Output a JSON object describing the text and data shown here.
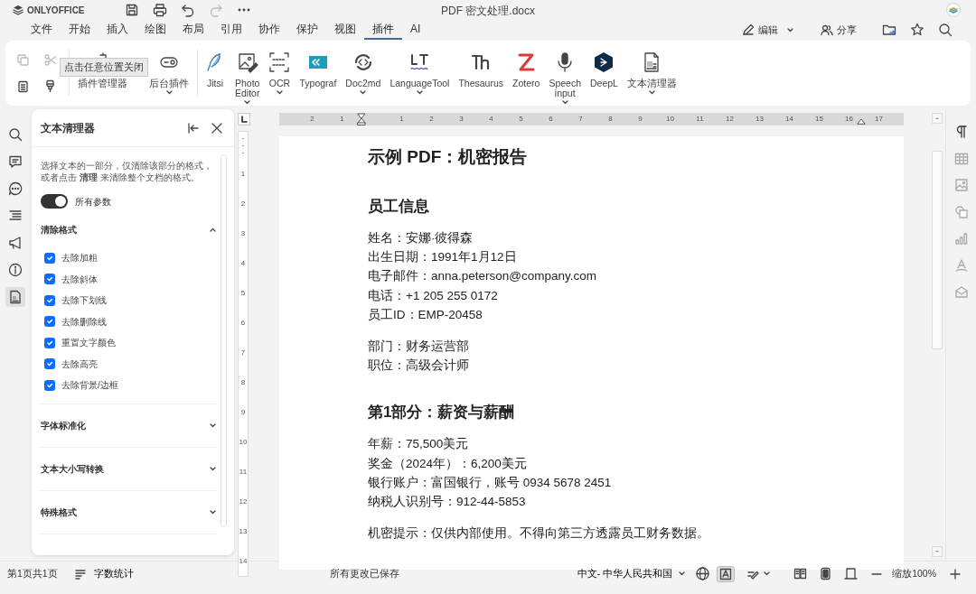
{
  "app": {
    "brand": "ONLYOFFICE",
    "title": "PDF 密文处理.docx"
  },
  "quick_access": {
    "undo": {
      "disabled": false
    },
    "redo": {
      "disabled": true
    }
  },
  "menu_tabs": [
    {
      "label": "文件",
      "selected": false
    },
    {
      "label": "开始",
      "selected": false
    },
    {
      "label": "插入",
      "selected": false
    },
    {
      "label": "绘图",
      "selected": false
    },
    {
      "label": "布局",
      "selected": false
    },
    {
      "label": "引用",
      "selected": false
    },
    {
      "label": "协作",
      "selected": false
    },
    {
      "label": "保护",
      "selected": false
    },
    {
      "label": "视图",
      "selected": false
    },
    {
      "label": "插件",
      "selected": true
    },
    {
      "label": "AI",
      "selected": false
    }
  ],
  "header_actions": {
    "edit_mode": "编辑",
    "share": "分享"
  },
  "toolbar": {
    "edit_buttons": [
      {
        "disabled": true
      },
      {
        "disabled": true
      },
      {
        "disabled": false
      },
      {
        "disabled": false
      }
    ],
    "tooltip": "点击任意位置关闭",
    "plugin_buttons": [
      {
        "label": "插件管理器",
        "dropdown": false
      },
      {
        "label": "后台插件",
        "dropdown": true
      }
    ],
    "plugins": [
      {
        "label": "Jitsi",
        "dropdown": false
      },
      {
        "label": "Photo Editor",
        "dropdown": true
      },
      {
        "label": "OCR",
        "dropdown": true
      },
      {
        "label": "Typograf",
        "dropdown": false
      },
      {
        "label": "Doc2md",
        "dropdown": true
      },
      {
        "label": "LanguageTool",
        "dropdown": true
      },
      {
        "label": "Thesaurus",
        "dropdown": false
      },
      {
        "label": "Zotero",
        "dropdown": false
      },
      {
        "label": "Speech input",
        "dropdown": true
      },
      {
        "label": "DeepL",
        "dropdown": false
      },
      {
        "label": "文本清理器",
        "dropdown": true
      }
    ]
  },
  "left_rail": [
    {
      "selected": false
    },
    {
      "selected": false
    },
    {
      "selected": false
    },
    {
      "selected": false
    },
    {
      "selected": false
    },
    {
      "selected": false
    },
    {
      "selected": true
    }
  ],
  "side_panel": {
    "title": "文本清理器",
    "description": "选择文本的一部分，仅清除该部分的格式，或者点击 **清理** 来清除整个文档的格式。",
    "toggle": {
      "label": "所有参数",
      "on": true
    },
    "sections": [
      {
        "title": "清除格式",
        "expanded": true,
        "options": [
          {
            "label": "去除加粗",
            "checked": true
          },
          {
            "label": "去除斜体",
            "checked": true
          },
          {
            "label": "去除下划线",
            "checked": true
          },
          {
            "label": "去除删除线",
            "checked": true
          },
          {
            "label": "重置文字颜色",
            "checked": true
          },
          {
            "label": "去除高亮",
            "checked": true
          },
          {
            "label": "去除背景/边框",
            "checked": true
          }
        ]
      },
      {
        "title": "字体标准化",
        "expanded": false
      },
      {
        "title": "文本大小写转换",
        "expanded": false
      },
      {
        "title": "特殊格式",
        "expanded": false
      }
    ]
  },
  "ruler": {
    "horizontal": [
      "2",
      "1",
      "1",
      "2",
      "3",
      "4",
      "5",
      "6",
      "7",
      "8",
      "9",
      "10",
      "11",
      "12",
      "13",
      "14",
      "15",
      "16",
      "17"
    ],
    "vertical": [
      "1",
      "2",
      "3",
      "4",
      "5",
      "6",
      "7",
      "8",
      "9",
      "10",
      "11",
      "12",
      "13",
      "14"
    ]
  },
  "document": [
    {
      "kind": "title",
      "text": "示例 PDF：机密报告"
    },
    {
      "kind": "heading",
      "text": "员工信息"
    },
    {
      "kind": "paragraph",
      "lines": [
        "姓名：安娜·彼得森",
        "出生日期：1991年1月12日",
        "电子邮件：anna.peterson@company.com",
        "电话：+1 205 255 0172",
        "员工ID：EMP-20458"
      ]
    },
    {
      "kind": "paragraph",
      "lines": [
        "部门：财务运营部",
        "职位：高级会计师"
      ]
    },
    {
      "kind": "heading",
      "text": "第1部分：薪资与薪酬"
    },
    {
      "kind": "paragraph",
      "lines": [
        "年薪：75,500美元",
        "奖金（2024年）：6,200美元",
        "银行账户：富国银行，账号 0934 5678 2451",
        "纳税人识别号：912-44-5853"
      ]
    },
    {
      "kind": "paragraph",
      "lines": [
        "机密提示：仅供内部使用。不得向第三方透露员工财务数据。"
      ]
    }
  ],
  "right_rail": [
    {
      "selected": true
    },
    {
      "selected": false
    },
    {
      "selected": false
    },
    {
      "selected": false
    },
    {
      "selected": false
    },
    {
      "selected": false
    },
    {
      "selected": false
    }
  ],
  "status_bar": {
    "page": "第1页共1页",
    "word_count": "字数统计",
    "save_state": "所有更改已保存",
    "language": "中文- 中华人民共和国",
    "spellcheck": true,
    "zoom": "缩放100%"
  }
}
